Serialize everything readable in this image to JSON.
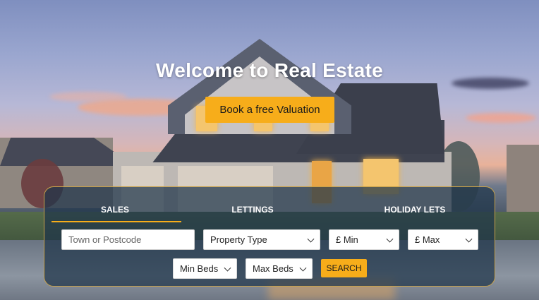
{
  "hero": {
    "title": "Welcome to Real Estate",
    "cta_label": "Book a free Valuation",
    "accent_color": "#f7ad1a"
  },
  "search_panel": {
    "tabs": [
      {
        "label": "SALES",
        "active": true
      },
      {
        "label": "LETTINGS",
        "active": false
      },
      {
        "label": "HOLIDAY LETS",
        "active": false
      }
    ],
    "location_placeholder": "Town or Postcode",
    "property_type": "Property Type",
    "min_price": "£ Min",
    "max_price": "£ Max",
    "min_beds": "Min Beds",
    "max_beds": "Max Beds",
    "search_label": "SEARCH",
    "dropdown_icon": "chevron-down-icon"
  }
}
